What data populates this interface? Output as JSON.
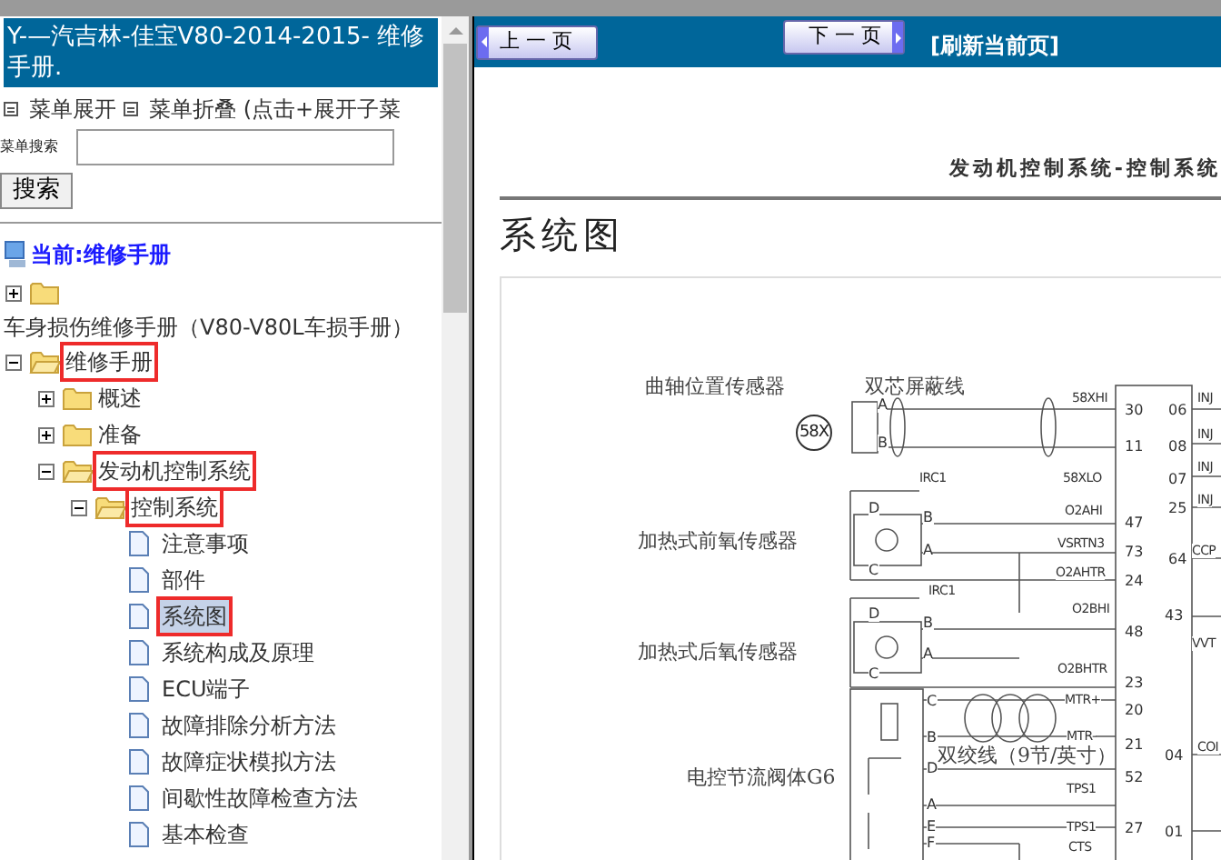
{
  "sidebar": {
    "title": "Y-—汽吉林-佳宝V80-2014-2015- 维修手册.",
    "menu_actions": [
      {
        "label": "菜单展开"
      },
      {
        "label": "菜单折叠 (点击+展开子菜"
      }
    ],
    "search": {
      "label": "菜单搜索",
      "button": "搜索"
    },
    "current": "当前:维修手册",
    "tree": [
      {
        "kind": "folder",
        "expanded": false
      },
      {
        "kind": "text",
        "label": "车身损伤维修手册（V80-V80L车损手册）"
      },
      {
        "kind": "folder",
        "label": "维修手册",
        "expanded": true,
        "marked": true,
        "selected": false,
        "children": [
          {
            "kind": "folder",
            "label": "概述",
            "expanded": false,
            "marked": false,
            "selected": false
          },
          {
            "kind": "folder",
            "label": "准备",
            "expanded": false,
            "marked": false,
            "selected": false
          },
          {
            "kind": "folder",
            "label": "发动机控制系统",
            "expanded": true,
            "marked": true,
            "selected": false,
            "children": [
              {
                "kind": "folder",
                "label": "控制系统",
                "expanded": true,
                "marked": true,
                "selected": false,
                "children": [
                  {
                    "kind": "page",
                    "label": "注意事项",
                    "marked": false,
                    "selected": false
                  },
                  {
                    "kind": "page",
                    "label": "部件",
                    "marked": false,
                    "selected": false
                  },
                  {
                    "kind": "page",
                    "label": "系统图",
                    "marked": true,
                    "selected": true
                  },
                  {
                    "kind": "page",
                    "label": "系统构成及原理",
                    "marked": false,
                    "selected": false
                  },
                  {
                    "kind": "page",
                    "label": "ECU端子",
                    "marked": false,
                    "selected": false
                  },
                  {
                    "kind": "page",
                    "label": "故障排除分析方法",
                    "marked": false,
                    "selected": false
                  },
                  {
                    "kind": "page",
                    "label": "故障症状模拟方法",
                    "marked": false,
                    "selected": false
                  },
                  {
                    "kind": "page",
                    "label": "间歇性故障检查方法",
                    "marked": false,
                    "selected": false
                  },
                  {
                    "kind": "page",
                    "label": "基本检查",
                    "marked": false,
                    "selected": false
                  }
                ]
              }
            ]
          }
        ]
      }
    ]
  },
  "toolbar": {
    "prev": "上 一 页",
    "next": "下 一 页",
    "refresh": "[刷新当前页]"
  },
  "document": {
    "header": "发动机控制系统-控制系统",
    "title": "系统图",
    "diagram_labels": [
      {
        "kind": "name",
        "text": "曲轴位置传感器"
      },
      {
        "kind": "name",
        "text": "双芯屏蔽线"
      },
      {
        "kind": "circle",
        "text": "58X"
      },
      {
        "kind": "pin",
        "text": "A"
      },
      {
        "kind": "pin",
        "text": "B"
      },
      {
        "kind": "signal",
        "text": "58XHI"
      },
      {
        "kind": "pin",
        "text": "30"
      },
      {
        "kind": "pin",
        "text": "11"
      },
      {
        "kind": "pin",
        "text": "06"
      },
      {
        "kind": "signal",
        "text": "INJ"
      },
      {
        "kind": "pin",
        "text": "08"
      },
      {
        "kind": "signal",
        "text": "INJ"
      },
      {
        "kind": "pin",
        "text": "07"
      },
      {
        "kind": "signal",
        "text": "INJ"
      },
      {
        "kind": "pin",
        "text": "25"
      },
      {
        "kind": "signal",
        "text": "INJ"
      },
      {
        "kind": "signal",
        "text": "IRC1"
      },
      {
        "kind": "signal",
        "text": "58XLO"
      },
      {
        "kind": "signal",
        "text": "O2AHI"
      },
      {
        "kind": "pin",
        "text": "47"
      },
      {
        "kind": "pin",
        "text": "D"
      },
      {
        "kind": "pin",
        "text": "B"
      },
      {
        "kind": "pin",
        "text": "A"
      },
      {
        "kind": "pin",
        "text": "C"
      },
      {
        "kind": "name",
        "text": "加热式前氧传感器"
      },
      {
        "kind": "signal",
        "text": "VSRTN3"
      },
      {
        "kind": "pin",
        "text": "73"
      },
      {
        "kind": "signal",
        "text": "O2AHTR"
      },
      {
        "kind": "pin",
        "text": "24"
      },
      {
        "kind": "pin",
        "text": "64"
      },
      {
        "kind": "signal",
        "text": "CCP"
      },
      {
        "kind": "signal",
        "text": "IRC1"
      },
      {
        "kind": "pin",
        "text": "D"
      },
      {
        "kind": "pin",
        "text": "B"
      },
      {
        "kind": "pin",
        "text": "A"
      },
      {
        "kind": "pin",
        "text": "C"
      },
      {
        "kind": "signal",
        "text": "O2BHI"
      },
      {
        "kind": "pin",
        "text": "48"
      },
      {
        "kind": "pin",
        "text": "43"
      },
      {
        "kind": "signal",
        "text": "VVT"
      },
      {
        "kind": "name",
        "text": "加热式后氧传感器"
      },
      {
        "kind": "signal",
        "text": "O2BHTR"
      },
      {
        "kind": "pin",
        "text": "23"
      },
      {
        "kind": "pin",
        "text": "C"
      },
      {
        "kind": "signal",
        "text": "MTR+"
      },
      {
        "kind": "pin",
        "text": "20"
      },
      {
        "kind": "pin",
        "text": "B"
      },
      {
        "kind": "signal",
        "text": "MTR-"
      },
      {
        "kind": "pin",
        "text": "21"
      },
      {
        "kind": "name",
        "text": "双绞线（9节/英寸）"
      },
      {
        "kind": "pin",
        "text": "04"
      },
      {
        "kind": "signal",
        "text": "COI"
      },
      {
        "kind": "name",
        "text": "电控节流阀体G6"
      },
      {
        "kind": "pin",
        "text": "D"
      },
      {
        "kind": "pin",
        "text": "52"
      },
      {
        "kind": "signal",
        "text": "TPS1"
      },
      {
        "kind": "pin",
        "text": "A"
      },
      {
        "kind": "pin",
        "text": "E"
      },
      {
        "kind": "signal",
        "text": "TPS1"
      },
      {
        "kind": "pin",
        "text": "27"
      },
      {
        "kind": "pin",
        "text": "F"
      },
      {
        "kind": "pin",
        "text": "01"
      },
      {
        "kind": "signal",
        "text": "CTS"
      }
    ]
  }
}
